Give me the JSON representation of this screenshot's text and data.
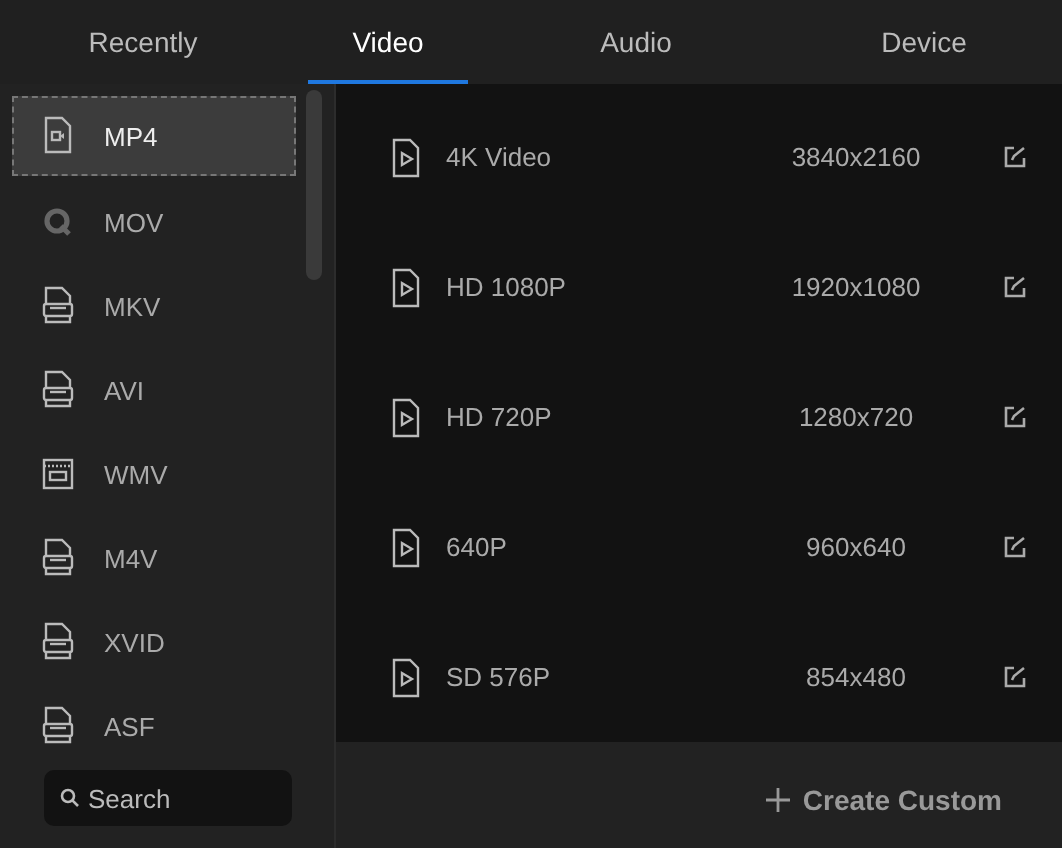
{
  "tabs": [
    {
      "label": "Recently",
      "selected": false
    },
    {
      "label": "Video",
      "selected": true
    },
    {
      "label": "Audio",
      "selected": false
    },
    {
      "label": "Device",
      "selected": false
    }
  ],
  "formats": [
    {
      "label": "MP4",
      "kind": "camera",
      "selected": true
    },
    {
      "label": "MOV",
      "kind": "q",
      "selected": false
    },
    {
      "label": "MKV",
      "kind": "doc",
      "selected": false
    },
    {
      "label": "AVI",
      "kind": "doc",
      "selected": false
    },
    {
      "label": "WMV",
      "kind": "film",
      "selected": false
    },
    {
      "label": "M4V",
      "kind": "doc",
      "selected": false
    },
    {
      "label": "XVID",
      "kind": "doc",
      "selected": false
    },
    {
      "label": "ASF",
      "kind": "doc",
      "selected": false
    }
  ],
  "search": {
    "placeholder": "Search"
  },
  "presets": [
    {
      "name": "4K Video",
      "resolution": "3840x2160"
    },
    {
      "name": "HD 1080P",
      "resolution": "1920x1080"
    },
    {
      "name": "HD 720P",
      "resolution": "1280x720"
    },
    {
      "name": "640P",
      "resolution": "960x640"
    },
    {
      "name": "SD 576P",
      "resolution": "854x480"
    }
  ],
  "create_button": "Create Custom"
}
